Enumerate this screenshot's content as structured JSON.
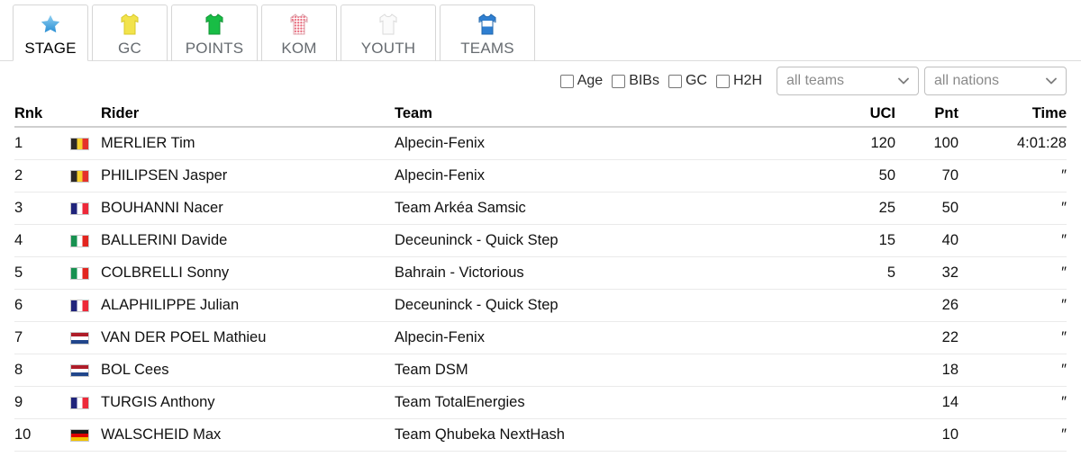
{
  "tabs": [
    {
      "label": "STAGE",
      "icon": "star-icon",
      "active": true
    },
    {
      "label": "GC",
      "icon": "yellow-jersey-icon",
      "active": false
    },
    {
      "label": "POINTS",
      "icon": "green-jersey-icon",
      "active": false
    },
    {
      "label": "KOM",
      "icon": "polkadot-jersey-icon",
      "active": false
    },
    {
      "label": "YOUTH",
      "icon": "white-jersey-icon",
      "active": false
    },
    {
      "label": "TEAMS",
      "icon": "blue-jersey-icon",
      "active": false
    }
  ],
  "filters": {
    "checkboxes": [
      {
        "label": "Age",
        "checked": false
      },
      {
        "label": "BIBs",
        "checked": false
      },
      {
        "label": "GC",
        "checked": false
      },
      {
        "label": "H2H",
        "checked": false
      }
    ],
    "team_select": {
      "value": "all teams",
      "placeholder": "all teams"
    },
    "nation_select": {
      "value": "all nations",
      "placeholder": "all nations"
    }
  },
  "table": {
    "headers": {
      "rnk": "Rnk",
      "rider": "Rider",
      "team": "Team",
      "uci": "UCI",
      "pnt": "Pnt",
      "time": "Time"
    },
    "rows": [
      {
        "rnk": "1",
        "flag": "be",
        "rider": "MERLIER Tim",
        "team": "Alpecin-Fenix",
        "uci": "120",
        "pnt": "100",
        "time": "4:01:28"
      },
      {
        "rnk": "2",
        "flag": "be",
        "rider": "PHILIPSEN Jasper",
        "team": "Alpecin-Fenix",
        "uci": "50",
        "pnt": "70",
        "time": "″"
      },
      {
        "rnk": "3",
        "flag": "fr",
        "rider": "BOUHANNI Nacer",
        "team": "Team Arkéa Samsic",
        "uci": "25",
        "pnt": "50",
        "time": "″"
      },
      {
        "rnk": "4",
        "flag": "it",
        "rider": "BALLERINI Davide",
        "team": "Deceuninck - Quick Step",
        "uci": "15",
        "pnt": "40",
        "time": "″"
      },
      {
        "rnk": "5",
        "flag": "it",
        "rider": "COLBRELLI Sonny",
        "team": "Bahrain - Victorious",
        "uci": "5",
        "pnt": "32",
        "time": "″"
      },
      {
        "rnk": "6",
        "flag": "fr",
        "rider": "ALAPHILIPPE Julian",
        "team": "Deceuninck - Quick Step",
        "uci": "",
        "pnt": "26",
        "time": "″"
      },
      {
        "rnk": "7",
        "flag": "nl",
        "rider": "VAN DER POEL Mathieu",
        "team": "Alpecin-Fenix",
        "uci": "",
        "pnt": "22",
        "time": "″"
      },
      {
        "rnk": "8",
        "flag": "nl",
        "rider": "BOL Cees",
        "team": "Team DSM",
        "uci": "",
        "pnt": "18",
        "time": "″"
      },
      {
        "rnk": "9",
        "flag": "fr",
        "rider": "TURGIS Anthony",
        "team": "Team TotalEnergies",
        "uci": "",
        "pnt": "14",
        "time": "″"
      },
      {
        "rnk": "10",
        "flag": "de",
        "rider": "WALSCHEID Max",
        "team": "Team Qhubeka NextHash",
        "uci": "",
        "pnt": "10",
        "time": "″"
      }
    ]
  },
  "colors": {
    "yellow_jersey": "#f2e34c",
    "green_jersey": "#18bd45",
    "polkadot_jersey": "#e8687a",
    "white_jersey": "#f4f4f4",
    "blue_jersey": "#2f7fd1",
    "star": "#4aa3e0",
    "row_border": "#eaeaea",
    "header_border": "#cfcfcf"
  }
}
